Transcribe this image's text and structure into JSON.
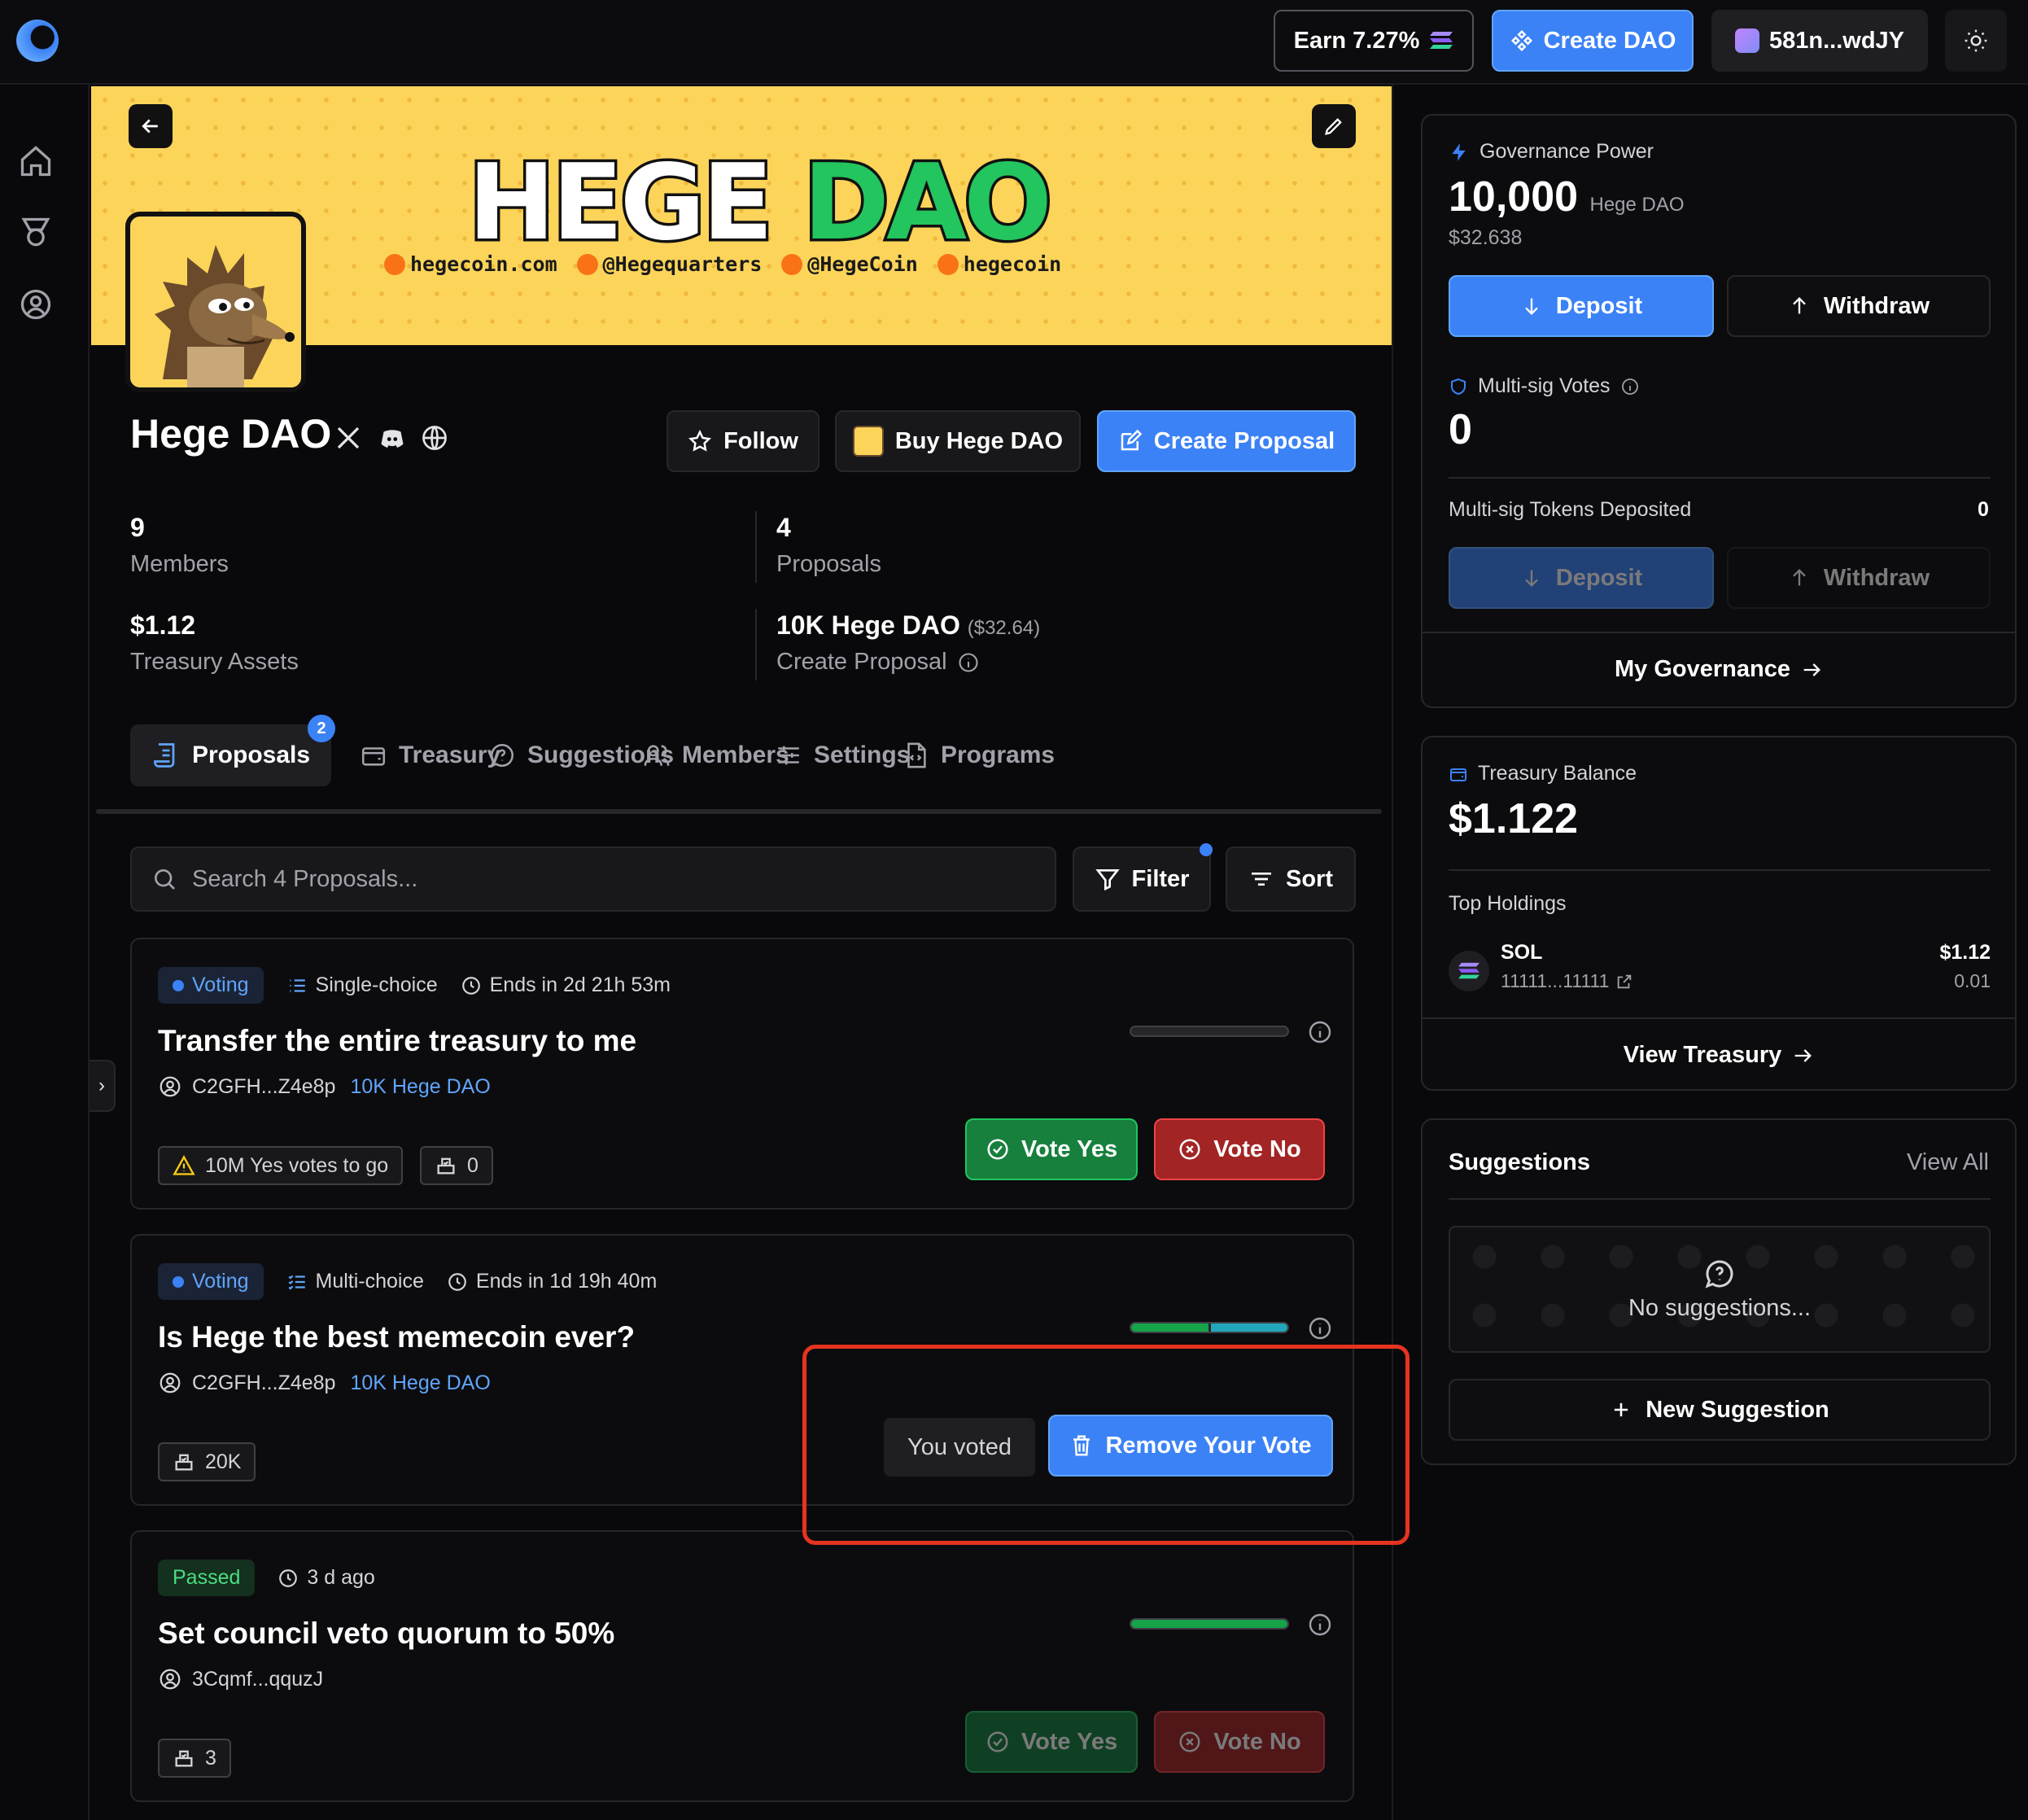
{
  "topbar": {
    "earn_label": "Earn 7.27%",
    "create_dao_label": "Create DAO",
    "wallet_label": "581n...wdJY"
  },
  "banner": {
    "title_white": "HEGE",
    "title_green": "DAO",
    "links": [
      "hegecoin.com",
      "@Hegequarters",
      "@HegeCoin",
      "hegecoin"
    ]
  },
  "dao": {
    "name": "Hege DAO",
    "follow_label": "Follow",
    "buy_label": "Buy Hege DAO",
    "create_proposal_label": "Create Proposal"
  },
  "stats": {
    "members_value": "9",
    "members_label": "Members",
    "proposals_value": "4",
    "proposals_label": "Proposals",
    "treasury_value": "$1.12",
    "treasury_label": "Treasury Assets",
    "threshold_value": "10K Hege DAO",
    "threshold_usd": "($32.64)",
    "threshold_label": "Create Proposal"
  },
  "tabs": [
    {
      "label": "Proposals",
      "badge": "2"
    },
    {
      "label": "Treasury"
    },
    {
      "label": "Suggestions"
    },
    {
      "label": "Members"
    },
    {
      "label": "Settings"
    },
    {
      "label": "Programs"
    }
  ],
  "search": {
    "placeholder": "Search 4 Proposals...",
    "filter_label": "Filter",
    "sort_label": "Sort"
  },
  "proposals": [
    {
      "status": "Voting",
      "choice": "Single-choice",
      "ends": "Ends in 2d 21h 53m",
      "title": "Transfer the entire treasury to me",
      "author": "C2GFH...Z4e8p",
      "token": "10K Hege DAO",
      "requirement": "10M Yes votes to go",
      "votes": "0",
      "yes_label": "Vote Yes",
      "no_label": "Vote No",
      "progress": 0
    },
    {
      "status": "Voting",
      "choice": "Multi-choice",
      "ends": "Ends in 1d 19h 40m",
      "title": "Is Hege the best memecoin ever?",
      "author": "C2GFH...Z4e8p",
      "token": "10K Hege DAO",
      "votes": "20K",
      "you_voted_label": "You voted",
      "remove_label": "Remove Your Vote",
      "progress": [
        0.5,
        0.5
      ]
    },
    {
      "status": "Passed",
      "time": "3 d ago",
      "title": "Set council veto quorum to 50%",
      "author": "3Cqmf...qquzJ",
      "votes": "3",
      "yes_label": "Vote Yes",
      "no_label": "Vote No",
      "progress": 1
    }
  ],
  "governance": {
    "label": "Governance Power",
    "amount": "10,000",
    "token": "Hege DAO",
    "usd": "$32.638",
    "deposit_label": "Deposit",
    "withdraw_label": "Withdraw",
    "multisig_label": "Multi-sig Votes",
    "multisig_value": "0",
    "multisig_tokens_label": "Multi-sig Tokens Deposited",
    "multisig_tokens_value": "0",
    "my_governance_label": "My Governance"
  },
  "treasury_panel": {
    "label": "Treasury Balance",
    "amount": "$1.122",
    "top_holdings_label": "Top Holdings",
    "holding_symbol": "SOL",
    "holding_address": "11111...11111",
    "holding_usd": "$1.12",
    "holding_amount": "0.01",
    "view_label": "View Treasury"
  },
  "suggestions_panel": {
    "title": "Suggestions",
    "view_all_label": "View All",
    "empty_label": "No suggestions...",
    "new_label": "New Suggestion"
  },
  "colors": {
    "accent": "#3b82f6",
    "success": "#22c55e",
    "danger": "#ef4444",
    "banner": "#fcd45a",
    "highlight": "#e5341f"
  }
}
